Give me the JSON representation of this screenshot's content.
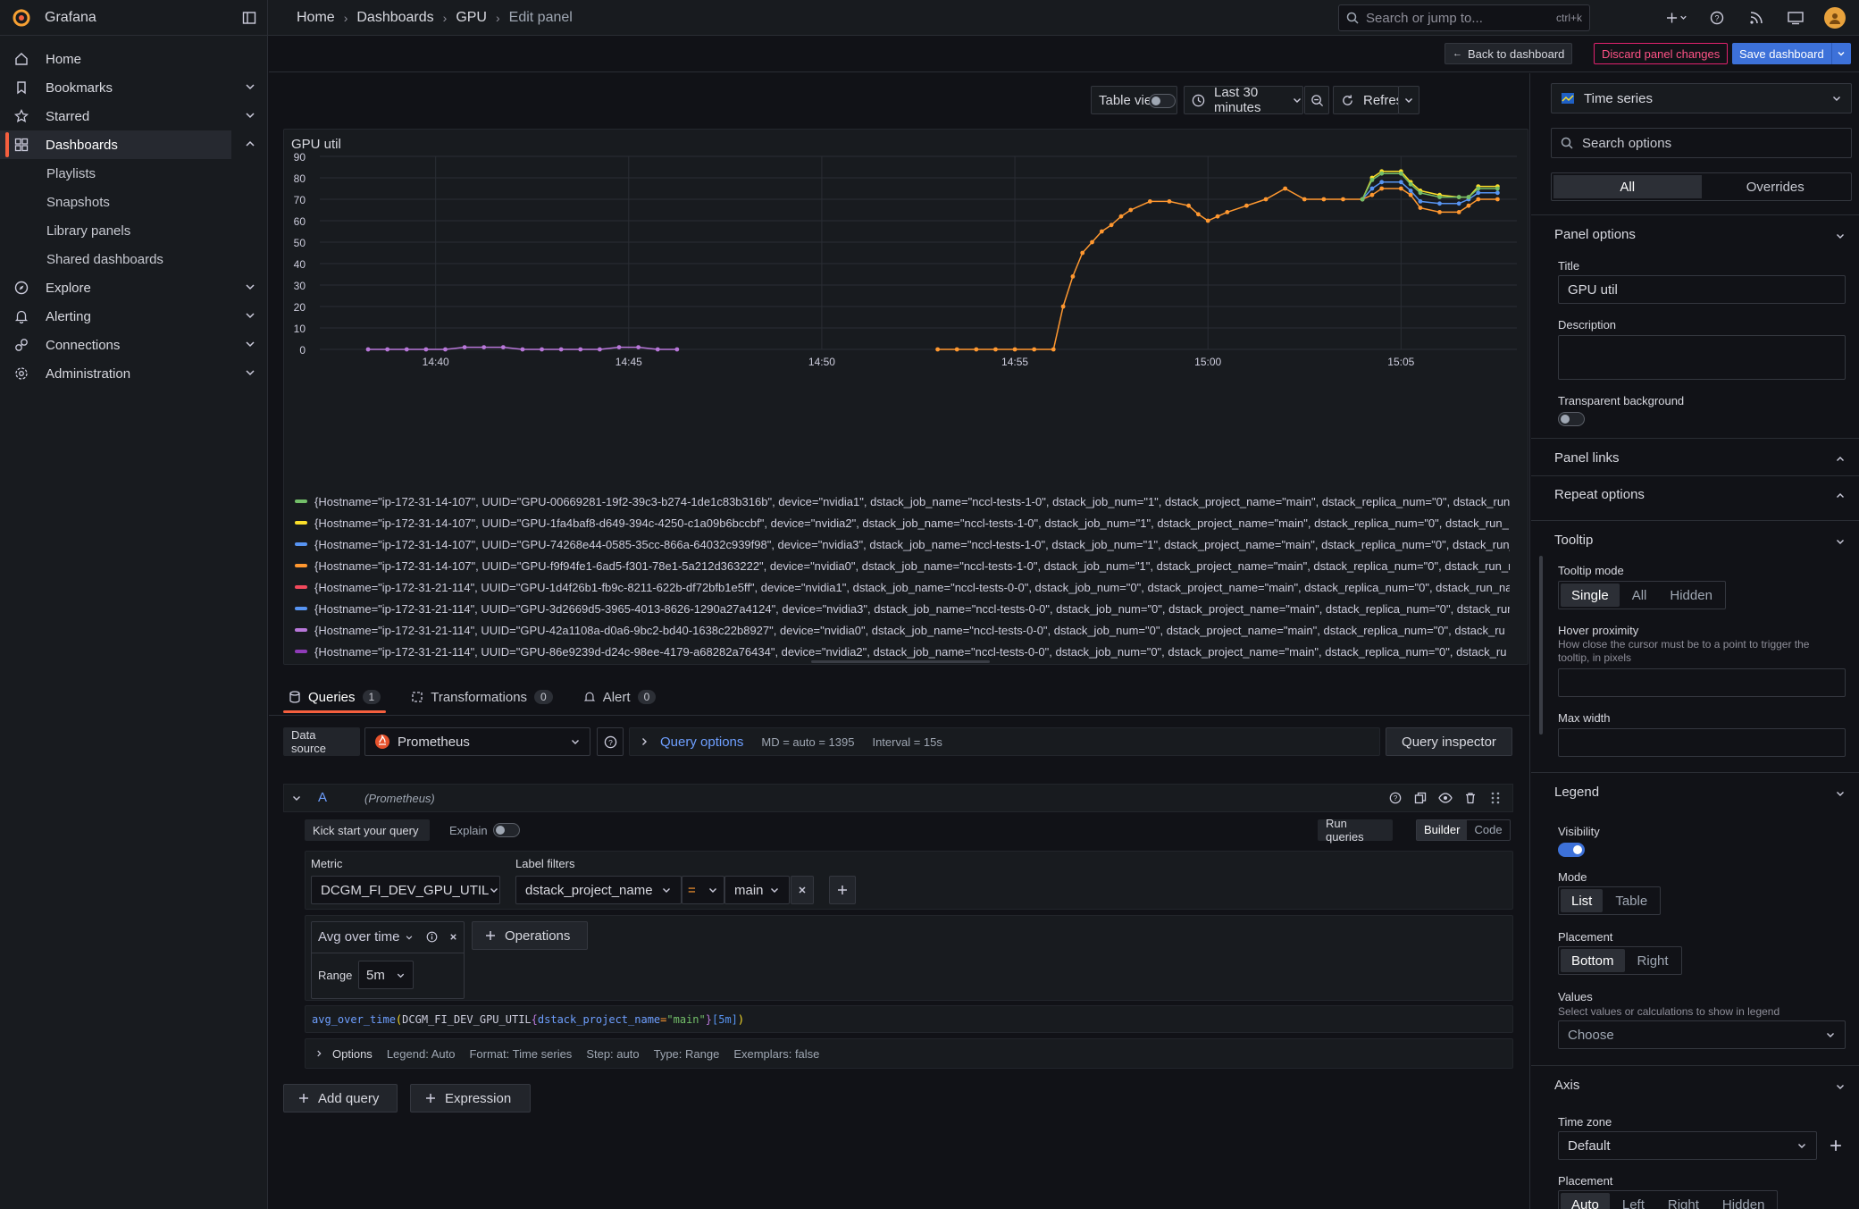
{
  "app": {
    "name": "Grafana"
  },
  "breadcrumb": [
    "Home",
    "Dashboards",
    "GPU",
    "Edit panel"
  ],
  "search": {
    "placeholder": "Search or jump to...",
    "shortcut": "ctrl+k"
  },
  "sidebar": {
    "items": [
      {
        "label": "Home",
        "icon": "home-icon"
      },
      {
        "label": "Bookmarks",
        "icon": "bookmark-icon"
      },
      {
        "label": "Starred",
        "icon": "star-icon"
      },
      {
        "label": "Dashboards",
        "icon": "apps-icon"
      },
      {
        "label": "Explore",
        "icon": "compass-icon"
      },
      {
        "label": "Alerting",
        "icon": "bell-icon"
      },
      {
        "label": "Connections",
        "icon": "plug-icon"
      },
      {
        "label": "Administration",
        "icon": "cog-icon"
      }
    ],
    "dashboard_children": [
      "Playlists",
      "Snapshots",
      "Library panels",
      "Shared dashboards"
    ]
  },
  "editbar": {
    "back": "Back to dashboard",
    "discard": "Discard panel changes",
    "save": "Save dashboard"
  },
  "panel_toolbar": {
    "table_view": "Table view",
    "time_range": "Last 30 minutes",
    "refresh": "Refresh"
  },
  "panel": {
    "title": "GPU util",
    "legend": [
      {
        "color": "#73bf69",
        "text": "{Hostname=\"ip-172-31-14-107\", UUID=\"GPU-00669281-19f2-39c3-b274-1de1c83b316b\", device=\"nvidia1\", dstack_job_name=\"nccl-tests-1-0\", dstack_job_num=\"1\", dstack_project_name=\"main\", dstack_replica_num=\"0\", dstack_run_"
      },
      {
        "color": "#fade2a",
        "text": "{Hostname=\"ip-172-31-14-107\", UUID=\"GPU-1fa4baf8-d649-394c-4250-c1a09b6bccbf\", device=\"nvidia2\", dstack_job_name=\"nccl-tests-1-0\", dstack_job_num=\"1\", dstack_project_name=\"main\", dstack_replica_num=\"0\", dstack_run_"
      },
      {
        "color": "#5794f2",
        "text": "{Hostname=\"ip-172-31-14-107\", UUID=\"GPU-74268e44-0585-35cc-866a-64032c939f98\", device=\"nvidia3\", dstack_job_name=\"nccl-tests-1-0\", dstack_job_num=\"1\", dstack_project_name=\"main\", dstack_replica_num=\"0\", dstack_run_"
      },
      {
        "color": "#ff9830",
        "text": "{Hostname=\"ip-172-31-14-107\", UUID=\"GPU-f9f94fe1-6ad5-f301-78e1-5a212d363222\", device=\"nvidia0\", dstack_job_name=\"nccl-tests-1-0\", dstack_job_num=\"1\", dstack_project_name=\"main\", dstack_replica_num=\"0\", dstack_run_n"
      },
      {
        "color": "#f2495c",
        "text": "{Hostname=\"ip-172-31-21-114\", UUID=\"GPU-1d4f26b1-fb9c-8211-622b-df72bfb1e5ff\", device=\"nvidia1\", dstack_job_name=\"nccl-tests-0-0\", dstack_job_num=\"0\", dstack_project_name=\"main\", dstack_replica_num=\"0\", dstack_run_na"
      },
      {
        "color": "#5794f2",
        "text": "{Hostname=\"ip-172-31-21-114\", UUID=\"GPU-3d2669d5-3965-4013-8626-1290a27a4124\", device=\"nvidia3\", dstack_job_name=\"nccl-tests-0-0\", dstack_job_num=\"0\", dstack_project_name=\"main\", dstack_replica_num=\"0\", dstack_run_"
      },
      {
        "color": "#b877d9",
        "text": "{Hostname=\"ip-172-31-21-114\", UUID=\"GPU-42a1108a-d0a6-9bc2-bd40-1638c22b8927\", device=\"nvidia0\", dstack_job_name=\"nccl-tests-0-0\", dstack_job_num=\"0\", dstack_project_name=\"main\", dstack_replica_num=\"0\", dstack_ru"
      },
      {
        "color": "#8f3bb8",
        "text": "{Hostname=\"ip-172-31-21-114\", UUID=\"GPU-86e9239d-d24c-98ee-4179-a68282a76434\", device=\"nvidia2\", dstack_job_name=\"nccl-tests-0-0\", dstack_job_num=\"0\", dstack_project_name=\"main\", dstack_replica_num=\"0\", dstack_ru"
      }
    ]
  },
  "chart_data": {
    "type": "line",
    "title": "GPU util",
    "xlabel": "",
    "ylabel": "",
    "x_ticks": [
      "14:40",
      "14:45",
      "14:50",
      "14:55",
      "15:00",
      "15:05"
    ],
    "y_ticks": [
      0,
      10,
      20,
      30,
      40,
      50,
      60,
      70,
      80,
      90
    ],
    "ylim": [
      0,
      90
    ],
    "xlim": [
      "14:37:00",
      "15:08:00"
    ],
    "grid": true,
    "legend_placement": "bottom",
    "series": [
      {
        "color": "#b877d9",
        "x": [
          "14:38:15",
          "14:38:45",
          "14:39:15",
          "14:39:45",
          "14:40:15",
          "14:40:45",
          "14:41:15",
          "14:41:45",
          "14:42:15",
          "14:42:45",
          "14:43:15",
          "14:43:45",
          "14:44:15",
          "14:44:45",
          "14:45:15",
          "14:45:45",
          "14:46:15"
        ],
        "y": [
          0,
          0,
          0,
          0,
          0,
          1,
          1,
          1,
          0,
          0,
          0,
          0,
          0,
          1,
          1,
          0,
          0
        ]
      },
      {
        "color": "#ff9830",
        "x": [
          "14:53:00",
          "14:53:30",
          "14:54:00",
          "14:54:30",
          "14:55:00",
          "14:55:30",
          "14:56:00",
          "14:56:15",
          "14:56:30",
          "14:56:45",
          "14:57:00",
          "14:57:15",
          "14:57:30",
          "14:57:45",
          "14:58:00",
          "14:58:30",
          "14:59:00",
          "14:59:30",
          "14:59:45",
          "15:00:00",
          "15:00:15",
          "15:00:30",
          "15:01:00",
          "15:01:30",
          "15:02:00",
          "15:02:30",
          "15:03:00",
          "15:03:30",
          "15:04:00",
          "15:04:15",
          "15:04:30",
          "15:05:00",
          "15:05:15",
          "15:05:30",
          "15:06:00",
          "15:06:30",
          "15:06:45",
          "15:07:00",
          "15:07:30"
        ],
        "y": [
          0,
          0,
          0,
          0,
          0,
          0,
          0,
          20,
          34,
          45,
          50,
          55,
          58,
          62,
          65,
          69,
          69,
          67,
          63,
          60,
          62,
          64,
          67,
          70,
          75,
          70,
          70,
          70,
          70,
          72,
          75,
          75,
          72,
          66,
          64,
          64,
          67,
          70,
          70
        ]
      },
      {
        "color": "#5794f2",
        "x": [
          "15:04:00",
          "15:04:15",
          "15:04:30",
          "15:05:00",
          "15:05:15",
          "15:05:30",
          "15:06:00",
          "15:06:30",
          "15:06:45",
          "15:07:00",
          "15:07:30"
        ],
        "y": [
          70,
          75,
          78,
          78,
          74,
          69,
          68,
          68,
          70,
          73,
          73
        ]
      },
      {
        "color": "#fade2a",
        "x": [
          "15:04:00",
          "15:04:15",
          "15:04:30",
          "15:05:00",
          "15:05:15",
          "15:05:30",
          "15:06:00",
          "15:06:30",
          "15:06:45",
          "15:07:00",
          "15:07:30"
        ],
        "y": [
          70,
          80,
          83,
          83,
          78,
          74,
          72,
          71,
          71,
          76,
          76
        ]
      },
      {
        "color": "#73bf69",
        "x": [
          "15:04:00",
          "15:04:15",
          "15:04:30",
          "15:05:00",
          "15:05:15",
          "15:05:30",
          "15:06:00",
          "15:06:30",
          "15:06:45",
          "15:07:00",
          "15:07:30"
        ],
        "y": [
          70,
          79,
          82,
          82,
          77,
          73,
          71,
          71,
          71,
          75,
          75
        ]
      }
    ]
  },
  "query_tabs": [
    {
      "label": "Queries",
      "count": "1"
    },
    {
      "label": "Transformations",
      "count": "0"
    },
    {
      "label": "Alert",
      "count": "0"
    }
  ],
  "datasource": {
    "label": "Data source",
    "value": "Prometheus",
    "query_options": "Query options",
    "md": "MD = auto = 1395",
    "interval": "Interval = 15s",
    "inspector": "Query inspector"
  },
  "query": {
    "ref": "A",
    "source": "(Prometheus)",
    "kick_start": "Kick start your query",
    "explain": "Explain",
    "run": "Run queries",
    "builder": "Builder",
    "code": "Code",
    "metric_label": "Metric",
    "metric": "DCGM_FI_DEV_GPU_UTIL",
    "label_filters": "Label filters",
    "filter_key": "dstack_project_name",
    "filter_op": "=",
    "filter_value": "main",
    "operation": "Avg over time",
    "operations_btn": "Operations",
    "range_label": "Range",
    "range": "5m",
    "expr_fn": "avg_over_time",
    "expr_metric": "DCGM_FI_DEV_GPU_UTIL",
    "expr_label": "dstack_project_name",
    "expr_value": "\"main\"",
    "expr_range": "[5m]",
    "options": "Options",
    "opt_legend": "Legend: Auto",
    "opt_format": "Format: Time series",
    "opt_step": "Step: auto",
    "opt_type": "Type: Range",
    "opt_exemplars": "Exemplars: false",
    "add_query": "Add query",
    "expression": "Expression"
  },
  "options_pane": {
    "viz": "Time series",
    "search_placeholder": "Search options",
    "tab_all": "All",
    "tab_overrides": "Overrides",
    "panel_options": "Panel options",
    "title_label": "Title",
    "title_value": "GPU util",
    "description_label": "Description",
    "transparent_label": "Transparent background",
    "panel_links": "Panel links",
    "repeat_options": "Repeat options",
    "tooltip": "Tooltip",
    "tooltip_mode": "Tooltip mode",
    "tooltip_modes": [
      "Single",
      "All",
      "Hidden"
    ],
    "hover_proximity": "Hover proximity",
    "hover_desc": "How close the cursor must be to a point to trigger the tooltip, in pixels",
    "max_width": "Max width",
    "legend": "Legend",
    "visibility": "Visibility",
    "mode": "Mode",
    "modes": [
      "List",
      "Table"
    ],
    "placement": "Placement",
    "placements": [
      "Bottom",
      "Right"
    ],
    "values": "Values",
    "values_desc": "Select values or calculations to show in legend",
    "values_placeholder": "Choose",
    "axis": "Axis",
    "time_zone": "Time zone",
    "time_zone_value": "Default",
    "axis_placement": "Placement",
    "axis_placements": [
      "Auto",
      "Left",
      "Right",
      "Hidden"
    ]
  },
  "colors": {
    "accent": "#f55f3e",
    "primary": "#3d71d9",
    "danger": "#e0226e"
  }
}
